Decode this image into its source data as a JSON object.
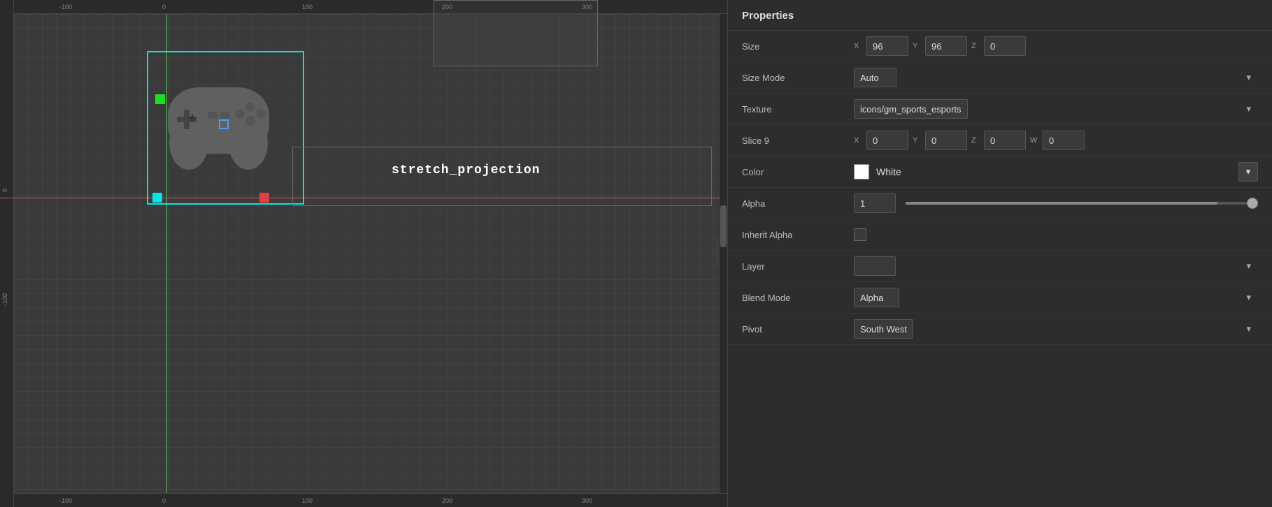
{
  "panel": {
    "title": "Properties",
    "rows": [
      {
        "id": "size",
        "label": "Size",
        "type": "coords4",
        "coords": [
          {
            "label": "X",
            "value": "96"
          },
          {
            "label": "Y",
            "value": "96"
          },
          {
            "label": "Z",
            "value": "0"
          }
        ]
      },
      {
        "id": "size_mode",
        "label": "Size Mode",
        "type": "dropdown",
        "value": "Auto"
      },
      {
        "id": "texture",
        "label": "Texture",
        "type": "dropdown",
        "value": "icons/gm_sports_esports"
      },
      {
        "id": "slice9",
        "label": "Slice 9",
        "type": "coords4",
        "coords": [
          {
            "label": "X",
            "value": "0"
          },
          {
            "label": "Y",
            "value": "0"
          },
          {
            "label": "Z",
            "value": "0"
          },
          {
            "label": "W",
            "value": "0"
          }
        ]
      },
      {
        "id": "color",
        "label": "Color",
        "type": "color",
        "color": "#ffffff",
        "value": "White"
      },
      {
        "id": "alpha",
        "label": "Alpha",
        "type": "slider",
        "value": "1"
      },
      {
        "id": "inherit_alpha",
        "label": "Inherit Alpha",
        "type": "checkbox",
        "checked": false
      },
      {
        "id": "layer",
        "label": "Layer",
        "type": "dropdown",
        "value": ""
      },
      {
        "id": "blend_mode",
        "label": "Blend Mode",
        "type": "dropdown",
        "value": "Alpha"
      },
      {
        "id": "pivot",
        "label": "Pivot",
        "type": "dropdown",
        "value": "South West"
      }
    ]
  },
  "canvas": {
    "stretch_label": "stretch_projection",
    "ruler_ticks_bottom": [
      "-100",
      "0",
      "100",
      "200",
      "300"
    ],
    "ruler_ticks_left": [
      "0",
      "-100"
    ]
  },
  "dropdown_arrow": "▾",
  "icons": {
    "chevron_down": "▾"
  }
}
